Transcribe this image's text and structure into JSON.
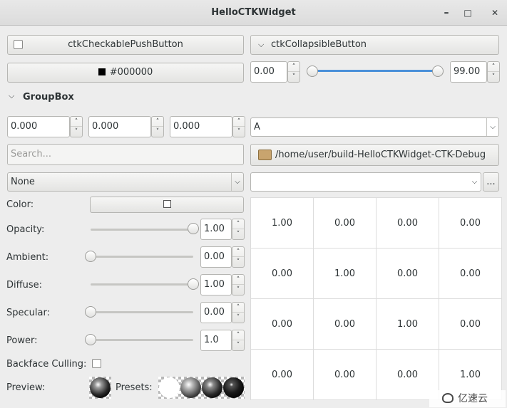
{
  "window": {
    "title": "HelloCTKWidget",
    "minimize_glyph": "–",
    "maximize_glyph": "□",
    "close_glyph": "✕"
  },
  "top": {
    "checkable_button_label": "ctkCheckablePushButton",
    "collapsible_button_label": "ctkCollapsibleButton",
    "color_button_label": "#000000",
    "range_min_value": "0.00",
    "range_max_value": "99.00"
  },
  "groupbox": {
    "title": "GroupBox",
    "coord_x": "0.000",
    "coord_y": "0.000",
    "coord_z": "0.000",
    "letter_combo_value": "A",
    "search_placeholder": "Search...",
    "directory_path": "/home/user/build-HelloCTKWidget-CTK-Debug",
    "none_combo_value": "None",
    "path_combo_value": "",
    "browse_button_label": "..."
  },
  "material": {
    "color_label": "Color:",
    "opacity_label": "Opacity:",
    "opacity_value": "1.00",
    "opacity_level": 1.0,
    "ambient_label": "Ambient:",
    "ambient_value": "0.00",
    "ambient_level": 0.0,
    "diffuse_label": "Diffuse:",
    "diffuse_value": "1.00",
    "diffuse_level": 1.0,
    "specular_label": "Specular:",
    "specular_value": "0.00",
    "specular_level": 0.0,
    "power_label": "Power:",
    "power_value": "1.0",
    "power_level": 0.0,
    "backface_label": "Backface Culling:",
    "backface_checked": false,
    "preview_label": "Preview:",
    "presets_label": "Presets:"
  },
  "matrix": {
    "rows": [
      [
        "1.00",
        "0.00",
        "0.00",
        "0.00"
      ],
      [
        "0.00",
        "1.00",
        "0.00",
        "0.00"
      ],
      [
        "0.00",
        "0.00",
        "1.00",
        "0.00"
      ],
      [
        "0.00",
        "0.00",
        "0.00",
        "1.00"
      ]
    ]
  },
  "watermark": {
    "text": "亿速云"
  },
  "colors": {
    "accent": "#4a90d9",
    "folder": "#c8a46e",
    "window_bg": "#ededed"
  }
}
